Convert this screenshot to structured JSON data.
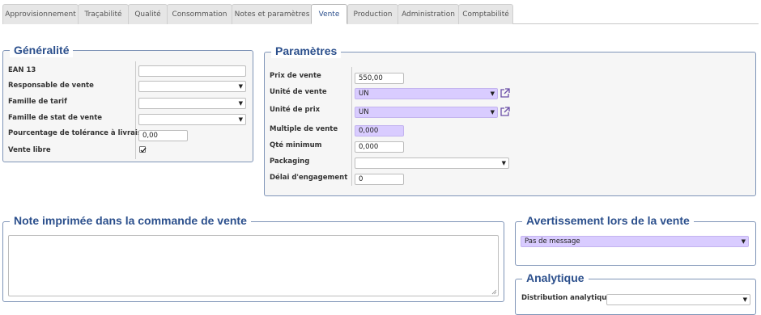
{
  "tabs": [
    {
      "label": "Approvisionnement"
    },
    {
      "label": "Traçabilité"
    },
    {
      "label": "Qualité"
    },
    {
      "label": "Consommation"
    },
    {
      "label": "Notes et paramètres"
    },
    {
      "label": "Vente"
    },
    {
      "label": "Production"
    },
    {
      "label": "Administration"
    },
    {
      "label": "Comptabilité"
    }
  ],
  "active_tab": "Vente",
  "generalite": {
    "title": "Généralité",
    "ean_label": "EAN 13",
    "ean_value": "",
    "responsable_label": "Responsable de vente",
    "responsable_value": "",
    "famille_tarif_label": "Famille de tarif",
    "famille_tarif_value": "",
    "famille_stat_label": "Famille de stat de vente",
    "famille_stat_value": "",
    "tolerance_label": "Pourcentage de tolérance à livraison",
    "tolerance_value": "0,00",
    "vente_libre_label": "Vente libre",
    "vente_libre_checked": true
  },
  "parametres": {
    "title": "Paramètres",
    "prix_label": "Prix de vente",
    "prix_value": "550,00",
    "unite_vente_label": "Unité de vente",
    "unite_vente_value": "UN",
    "unite_prix_label": "Unité de prix",
    "unite_prix_value": "UN",
    "multiple_label": "Multiple de vente",
    "multiple_value": "0,000",
    "qte_min_label": "Qté minimum",
    "qte_min_value": "0,000",
    "packaging_label": "Packaging",
    "packaging_value": "",
    "delai_label": "Délai d'engagement",
    "delai_value": "0"
  },
  "note": {
    "title": "Note imprimée dans la commande de vente",
    "value": ""
  },
  "avertissement": {
    "title": "Avertissement lors de la vente",
    "value": "Pas de message"
  },
  "analytique": {
    "title": "Analytique",
    "distribution_label": "Distribution analytique",
    "distribution_value": ""
  },
  "colors": {
    "accent": "#2b4f8c",
    "purple_field": "#d9ccff",
    "external_link": "#6b4fa8"
  }
}
